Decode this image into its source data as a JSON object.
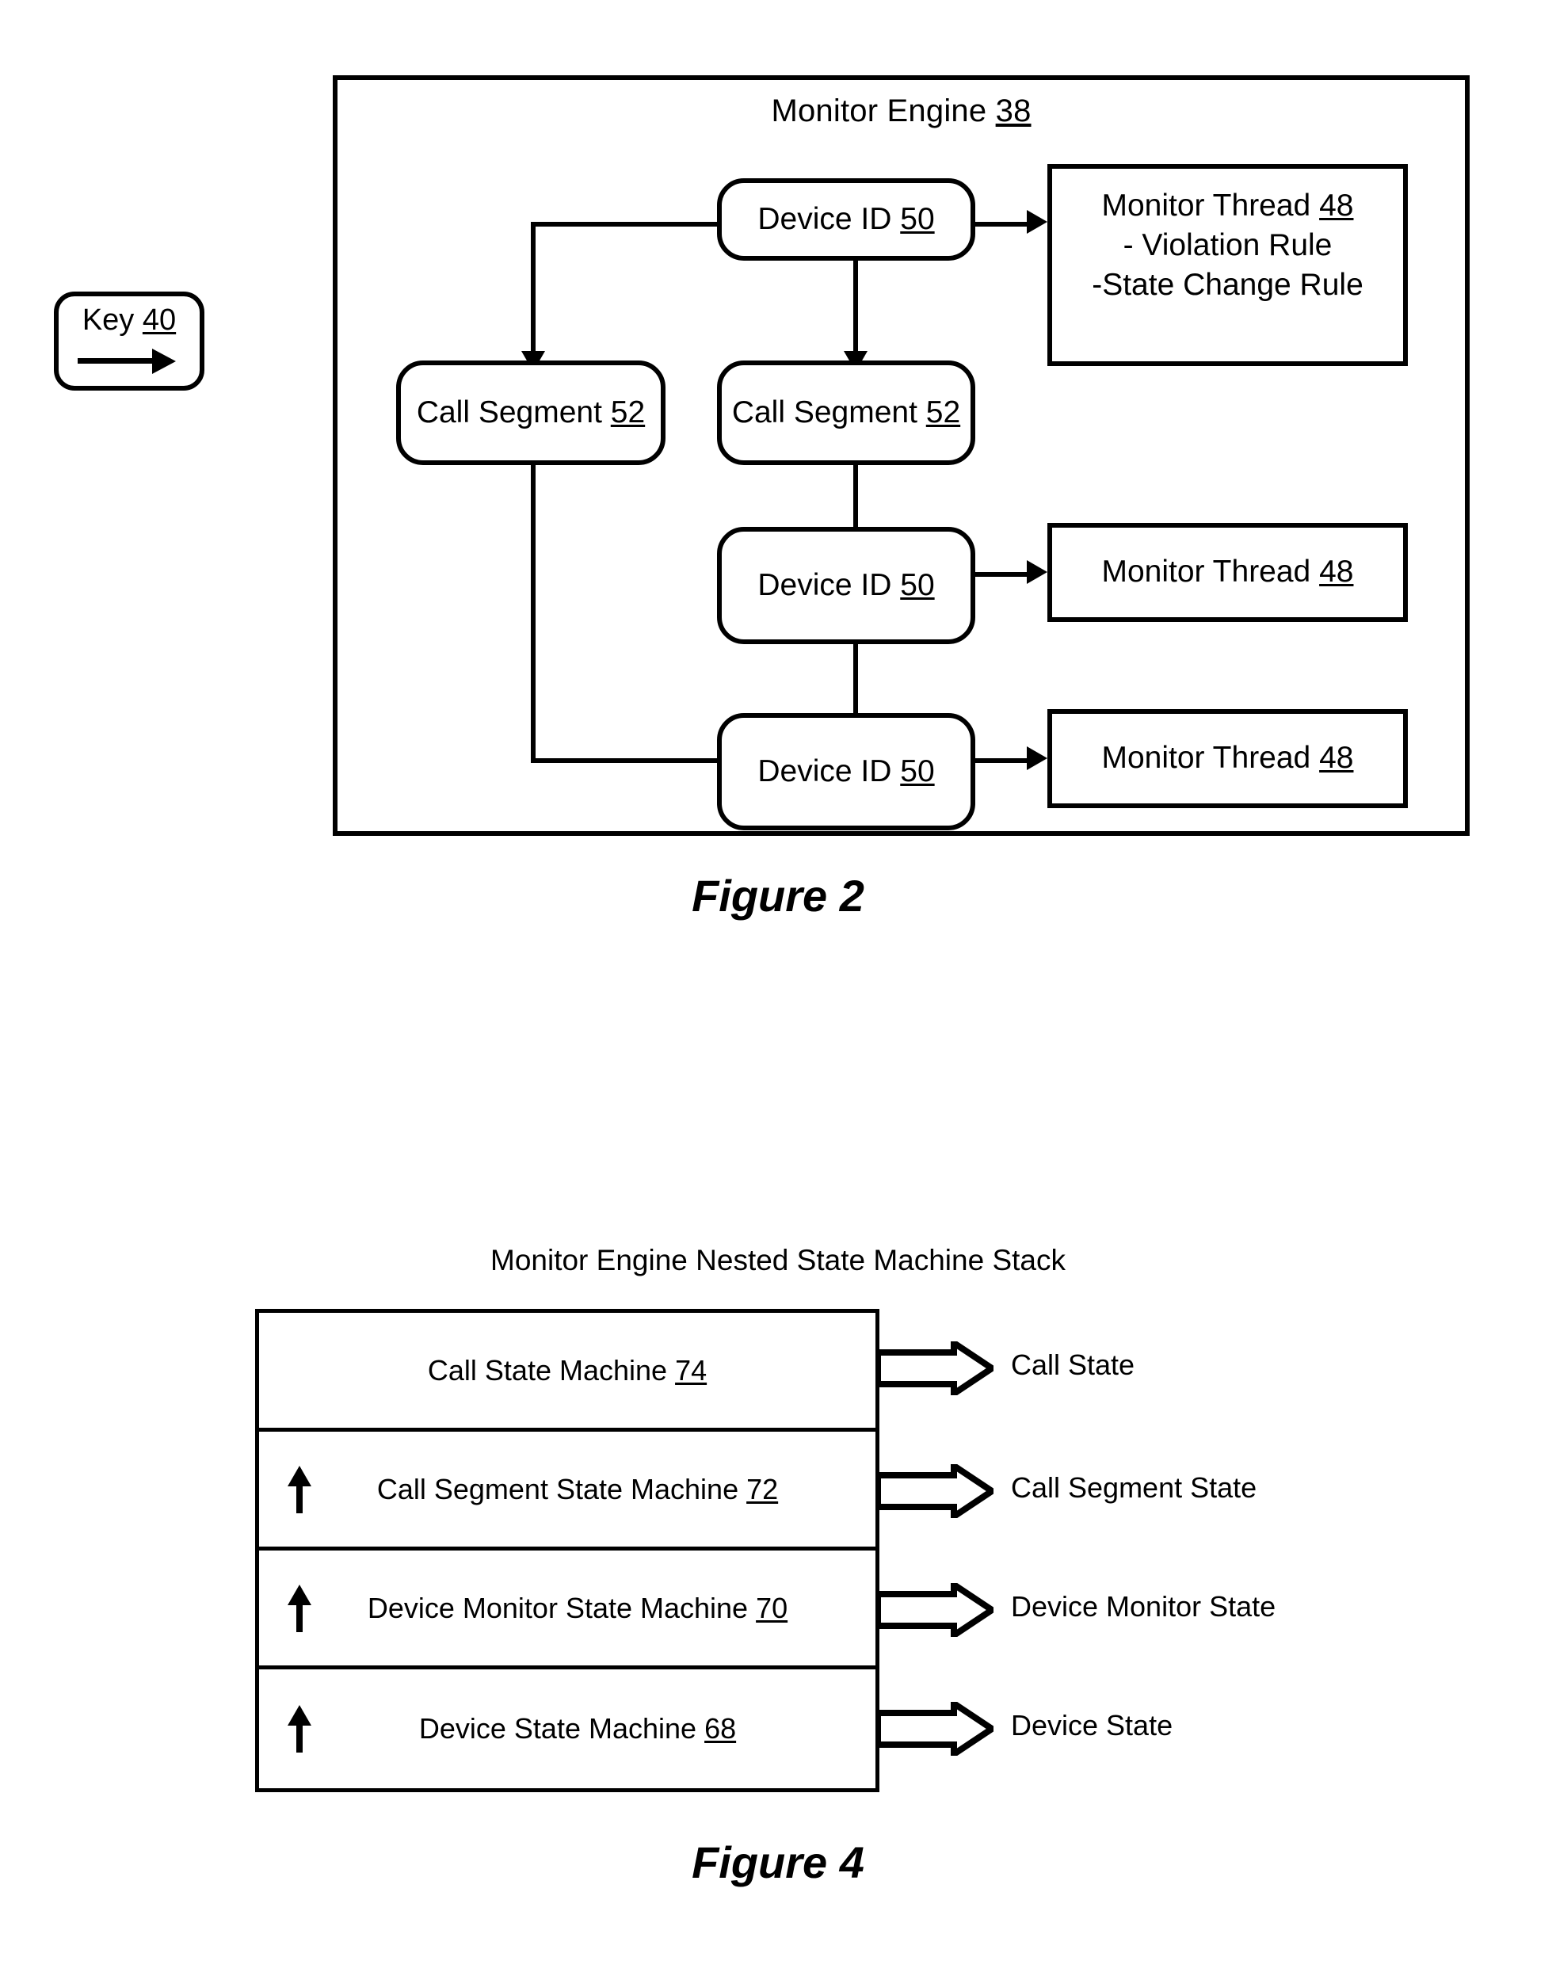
{
  "figure2": {
    "caption": "Figure 2",
    "engine_title": "Monitor Engine 38",
    "engine_title_text": "Monitor Engine",
    "engine_title_ref": "38",
    "key": {
      "label_text": "Key",
      "label_ref": "40",
      "arrow_icon": "arrow-right-icon"
    },
    "nodes": {
      "device_id_top": {
        "text": "Device ID",
        "ref": "50"
      },
      "device_id_mid": {
        "text": "Device ID",
        "ref": "50"
      },
      "device_id_bottom": {
        "text": "Device ID",
        "ref": "50"
      },
      "call_segment_left": {
        "text": "Call Segment",
        "ref": "52"
      },
      "call_segment_center": {
        "text": "Call Segment",
        "ref": "52"
      },
      "monitor_thread_top": {
        "text": "Monitor Thread",
        "ref": "48",
        "rules": [
          "- Violation Rule",
          "-State Change Rule"
        ]
      },
      "monitor_thread_mid": {
        "text": "Monitor Thread",
        "ref": "48"
      },
      "monitor_thread_bottom": {
        "text": "Monitor Thread",
        "ref": "48"
      }
    }
  },
  "figure4": {
    "caption": "Figure 4",
    "title": "Monitor Engine Nested State Machine Stack",
    "rows": [
      {
        "text": "Call State Machine",
        "ref": "74",
        "has_up_arrow": false,
        "output": "Call State"
      },
      {
        "text": "Call Segment State Machine",
        "ref": "72",
        "has_up_arrow": true,
        "output": "Call Segment State"
      },
      {
        "text": "Device Monitor State Machine",
        "ref": "70",
        "has_up_arrow": true,
        "output": "Device Monitor State"
      },
      {
        "text": "Device State Machine",
        "ref": "68",
        "has_up_arrow": true,
        "output": "Device State"
      }
    ]
  },
  "colors": {
    "ink": "#000000",
    "paper": "#ffffff"
  }
}
